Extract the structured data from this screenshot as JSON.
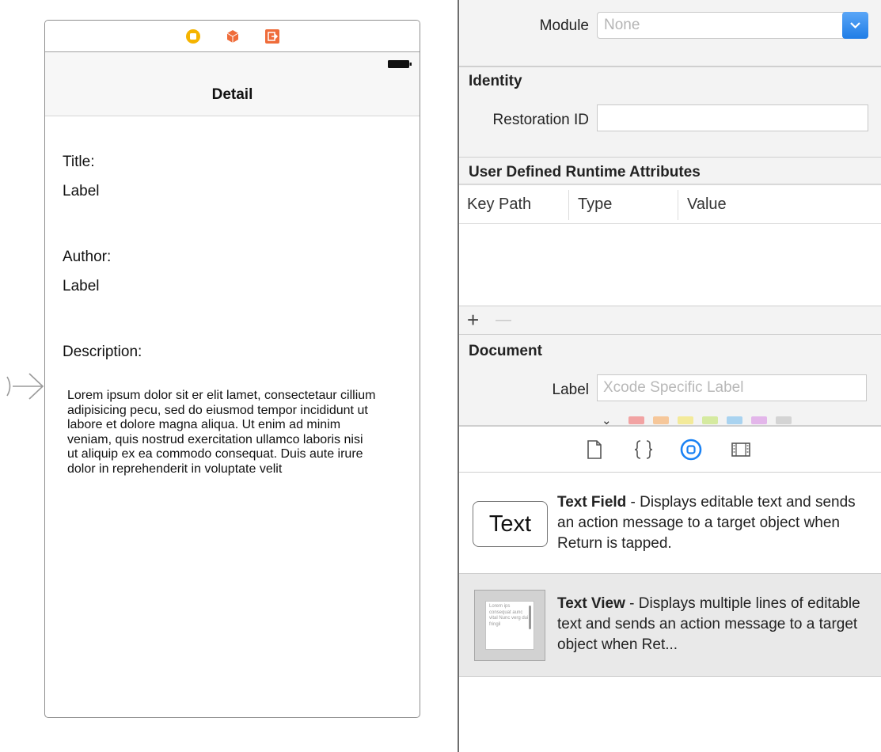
{
  "scene": {
    "nav_title": "Detail",
    "title_caption": "Title:",
    "title_value": "Label",
    "author_caption": "Author:",
    "author_value": "Label",
    "description_caption": "Description:",
    "description_text": "Lorem ipsum dolor sit er elit lamet, consectetaur cillium adipisicing pecu, sed do eiusmod tempor incididunt ut labore et dolore magna aliqua. Ut enim ad minim veniam, quis nostrud exercitation ullamco laboris nisi ut aliquip ex ea commodo consequat. Duis aute irure dolor in reprehenderit in voluptate velit"
  },
  "inspector": {
    "module_label": "Module",
    "module_value": "None",
    "identity_title": "Identity",
    "restoration_id_label": "Restoration ID",
    "restoration_id_value": "",
    "runtime_attributes_title": "User Defined Runtime Attributes",
    "columns": [
      "Key Path",
      "Type",
      "Value"
    ],
    "add_symbol": "+",
    "remove_symbol": "—",
    "document_title": "Document",
    "doc_label_label": "Label",
    "doc_label_placeholder": "Xcode Specific Label",
    "chevron": "⌄",
    "label_colors": [
      "#f2a3a3",
      "#f6c79a",
      "#f3ea9a",
      "#d5eaa0",
      "#a9d3f0",
      "#e3b6ea",
      "#d4d4d4"
    ]
  },
  "library": {
    "text_field": {
      "icon_text": "Text",
      "name": "Text Field",
      "description": " - Displays editable text and sends an action message to a target object when Return is tapped."
    },
    "text_view": {
      "name": "Text View",
      "description": " - Displays multiple lines of editable text and sends an action message to a target object when Ret...",
      "thumb_text": "Lorem ips consequat aunc vital Nunc verg dui fringil"
    }
  },
  "colors": {
    "accent_blue": "#1a82f4",
    "dock_yellow": "#f5b400",
    "dock_orange": "#ef6c3a"
  }
}
